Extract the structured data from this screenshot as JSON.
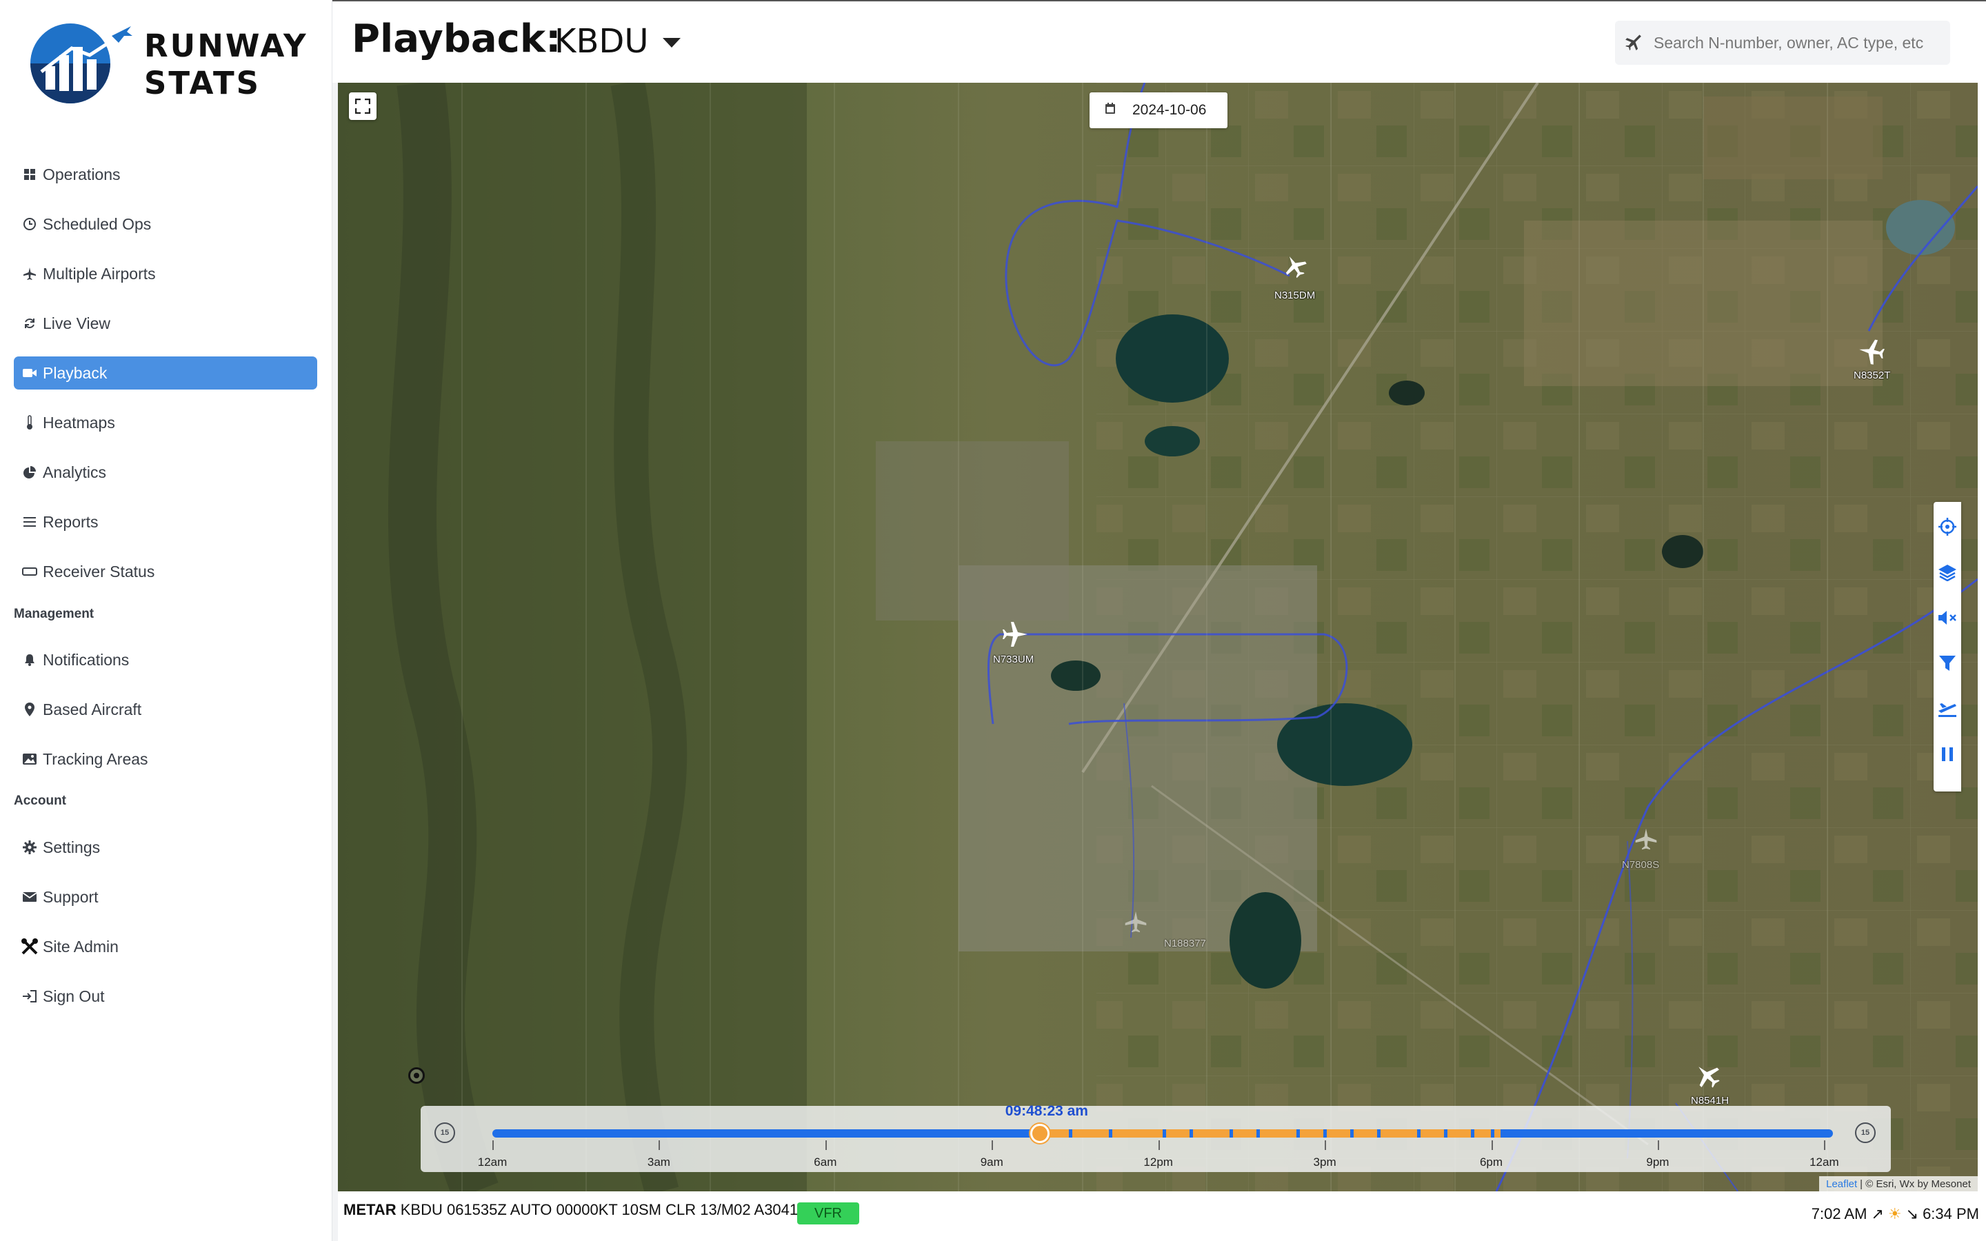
{
  "app": {
    "name_line1": "RUNWAY",
    "name_line2": "STATS"
  },
  "sidebar": {
    "items": [
      {
        "label": "Operations",
        "icon": "grid-icon"
      },
      {
        "label": "Scheduled Ops",
        "icon": "clock-icon"
      },
      {
        "label": "Multiple Airports",
        "icon": "plane-icon"
      },
      {
        "label": "Live View",
        "icon": "refresh-icon"
      },
      {
        "label": "Playback",
        "icon": "video-icon",
        "active": true
      },
      {
        "label": "Heatmaps",
        "icon": "thermometer-icon"
      },
      {
        "label": "Analytics",
        "icon": "pie-chart-icon"
      },
      {
        "label": "Reports",
        "icon": "list-icon"
      },
      {
        "label": "Receiver Status",
        "icon": "receiver-icon"
      }
    ],
    "management_label": "Management",
    "management_items": [
      {
        "label": "Notifications",
        "icon": "bell-icon"
      },
      {
        "label": "Based Aircraft",
        "icon": "map-pin-icon"
      },
      {
        "label": "Tracking Areas",
        "icon": "image-icon"
      }
    ],
    "account_label": "Account",
    "account_items": [
      {
        "label": "Settings",
        "icon": "gear-icon"
      },
      {
        "label": "Support",
        "icon": "envelope-icon"
      },
      {
        "label": "Site Admin",
        "icon": "tools-icon"
      },
      {
        "label": "Sign Out",
        "icon": "sign-out-icon"
      }
    ]
  },
  "header": {
    "title": "Playback:",
    "airport": "KBDU",
    "search_placeholder": "Search N-number, owner, AC type, etc"
  },
  "map": {
    "date": "2024-10-06",
    "aircraft_labels": [
      "N315DM",
      "N8352T",
      "N733UM",
      "N7808S",
      "N188377",
      "N8541H"
    ],
    "tools": [
      "crosshair-icon",
      "layers-icon",
      "mute-icon",
      "filter-icon",
      "departure-icon",
      "pause-icon"
    ],
    "attribution_leaflet": "Leaflet",
    "attribution_rest": "| © Esri, Wx by Mesonet"
  },
  "timeline": {
    "current_time": "09:48:23 am",
    "skip_back_label": "15",
    "skip_fwd_label": "15",
    "ticks": [
      "12am",
      "3am",
      "6am",
      "9am",
      "12pm",
      "3pm",
      "6pm",
      "9pm",
      "12am"
    ],
    "progress": 0.4083,
    "activity_window": [
      0.405,
      0.752
    ],
    "colors": {
      "track": "#1f6ee8",
      "active": "#f4a23a"
    }
  },
  "footer": {
    "metar_label": "METAR",
    "metar_text": "KBDU 061535Z AUTO 00000KT 10SM CLR 13/M02 A3041",
    "flight_category": "VFR",
    "sunrise": "7:02 AM",
    "sunset": "6:34 PM"
  }
}
